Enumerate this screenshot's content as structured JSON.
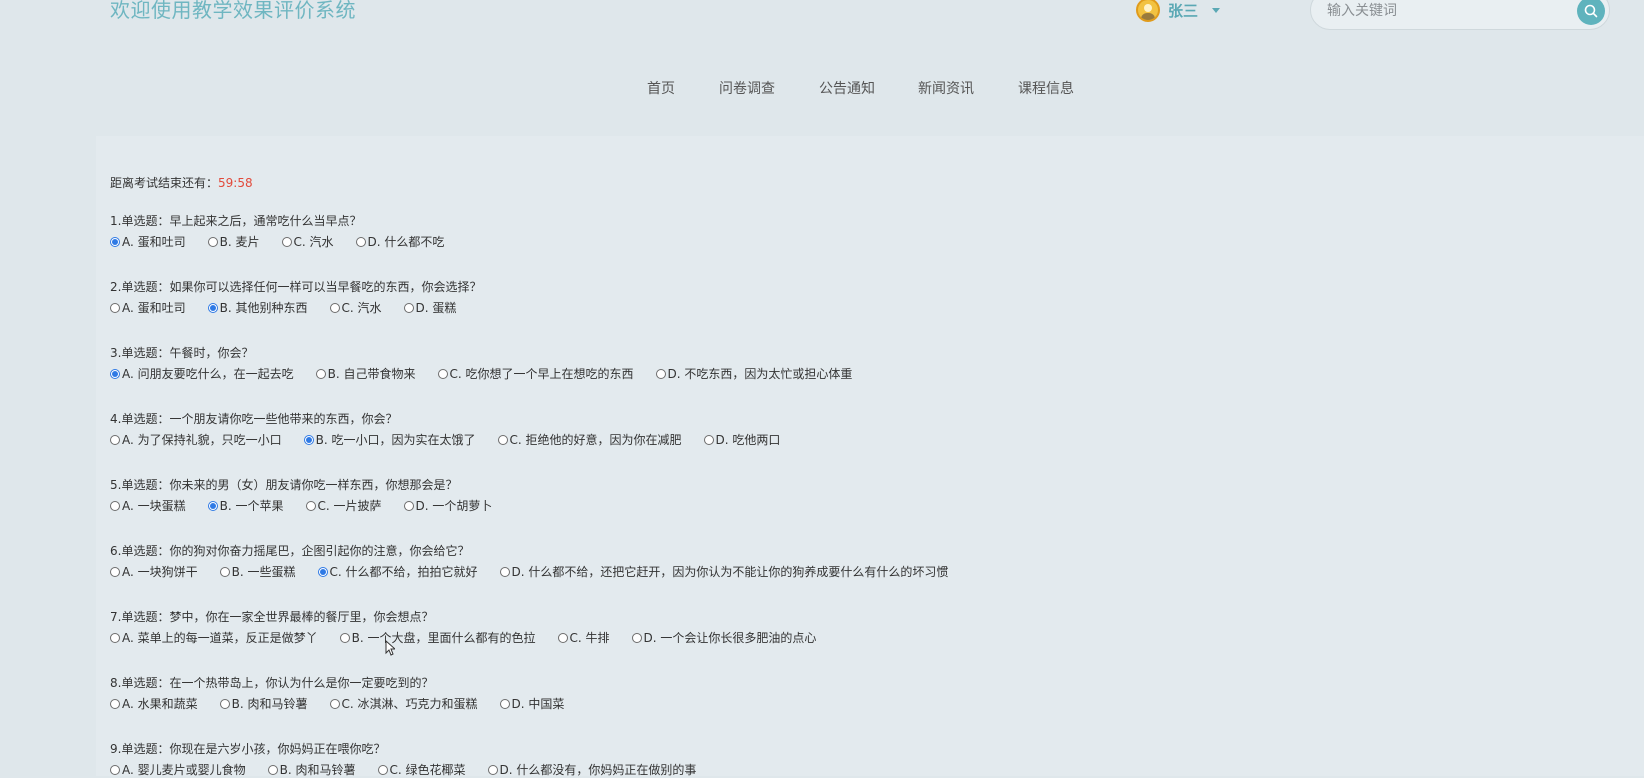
{
  "header": {
    "site_title": "欢迎使用教学效果评价系统",
    "user_name": "张三",
    "search_placeholder": "输入关键词"
  },
  "nav": {
    "items": [
      {
        "label": "首页"
      },
      {
        "label": "问卷调查"
      },
      {
        "label": "公告通知"
      },
      {
        "label": "新闻资讯"
      },
      {
        "label": "课程信息"
      }
    ]
  },
  "exam": {
    "timer_label": "距离考试结束还有：",
    "timer_value": "59:58",
    "questions": [
      {
        "title": "1.单选题：早上起来之后，通常吃什么当早点？",
        "options": [
          "A. 蛋和吐司",
          "B. 麦片",
          "C. 汽水",
          "D. 什么都不吃"
        ],
        "selected": 0
      },
      {
        "title": "2.单选题：如果你可以选择任何一样可以当早餐吃的东西，你会选择？",
        "options": [
          "A. 蛋和吐司",
          "B. 其他别种东西",
          "C. 汽水",
          "D. 蛋糕"
        ],
        "selected": 1
      },
      {
        "title": "3.单选题：午餐时，你会？",
        "options": [
          "A. 问朋友要吃什么，在一起去吃",
          "B. 自己带食物来",
          "C. 吃你想了一个早上在想吃的东西",
          "D. 不吃东西，因为太忙或担心体重"
        ],
        "selected": 0
      },
      {
        "title": "4.单选题：一个朋友请你吃一些他带来的东西，你会？",
        "options": [
          "A. 为了保持礼貌，只吃一小口",
          "B. 吃一小口，因为实在太饿了",
          "C. 拒绝他的好意，因为你在减肥",
          "D. 吃他两口"
        ],
        "selected": 1
      },
      {
        "title": "5.单选题：你未来的男（女）朋友请你吃一样东西，你想那会是？",
        "options": [
          "A. 一块蛋糕",
          "B. 一个苹果",
          "C. 一片披萨",
          "D. 一个胡萝卜"
        ],
        "selected": 1
      },
      {
        "title": "6.单选题：你的狗对你奋力摇尾巴，企图引起你的注意，你会给它？",
        "options": [
          "A. 一块狗饼干",
          "B. 一些蛋糕",
          "C. 什么都不给，拍拍它就好",
          "D. 什么都不给，还把它赶开，因为你认为不能让你的狗养成要什么有什么的坏习惯"
        ],
        "selected": 2
      },
      {
        "title": "7.单选题：梦中，你在一家全世界最棒的餐厅里，你会想点？",
        "options": [
          "A. 菜单上的每一道菜，反正是做梦丫",
          "B. 一个大盘，里面什么都有的色拉",
          "C. 牛排",
          "D. 一个会让你长很多肥油的点心"
        ],
        "selected": -1
      },
      {
        "title": "8.单选题：在一个热带岛上，你认为什么是你一定要吃到的？",
        "options": [
          "A. 水果和蔬菜",
          "B. 肉和马铃薯",
          "C. 冰淇淋、巧克力和蛋糕",
          "D. 中国菜"
        ],
        "selected": -1
      },
      {
        "title": "9.单选题：你现在是六岁小孩，你妈妈正在喂你吃？",
        "options": [
          "A. 婴儿麦片或婴儿食物",
          "B. 肉和马铃薯",
          "C. 绿色花椰菜",
          "D. 什么都没有，你妈妈正在做别的事"
        ],
        "selected": -1
      }
    ]
  },
  "colors": {
    "accent": "#5fb3bd",
    "timer": "#e24a3b",
    "radio_checked": "#2f7ae5"
  }
}
